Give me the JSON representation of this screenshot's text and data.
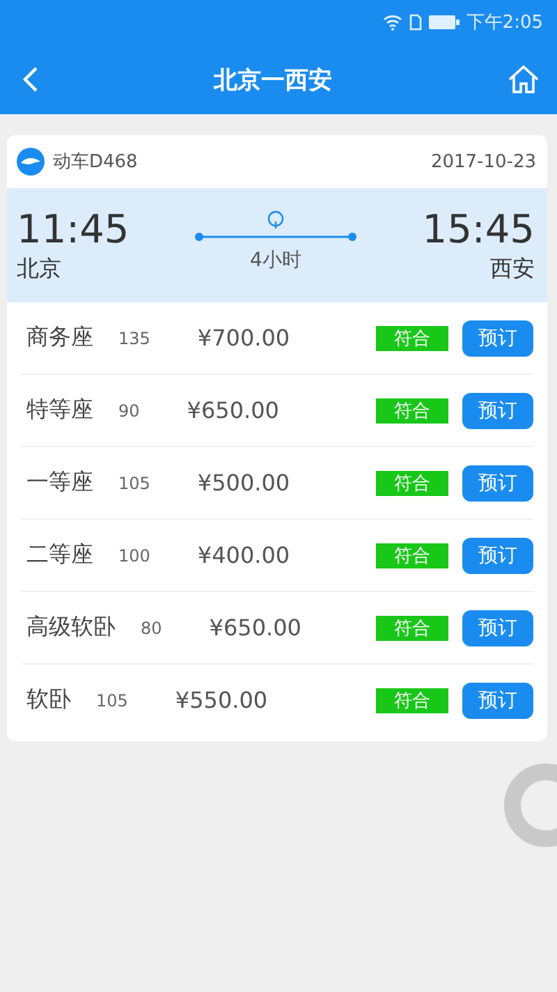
{
  "status_bar": {
    "time": "下午2:05"
  },
  "header": {
    "title": "北京一西安"
  },
  "train": {
    "name": "动车D468",
    "date": "2017-10-23",
    "depart_time": "11:45",
    "depart_station": "北京",
    "arrive_time": "15:45",
    "arrive_station": "西安",
    "duration": "4小时"
  },
  "seats": [
    {
      "name": "商务座",
      "count": "135",
      "price": "¥700.00",
      "tag": "符合",
      "button": "预订"
    },
    {
      "name": "特等座",
      "count": "90",
      "price": "¥650.00",
      "tag": "符合",
      "button": "预订"
    },
    {
      "name": "一等座",
      "count": "105",
      "price": "¥500.00",
      "tag": "符合",
      "button": "预订"
    },
    {
      "name": "二等座",
      "count": "100",
      "price": "¥400.00",
      "tag": "符合",
      "button": "预订"
    },
    {
      "name": "高级软卧",
      "count": "80",
      "price": "¥650.00",
      "tag": "符合",
      "button": "预订"
    },
    {
      "name": "软卧",
      "count": "105",
      "price": "¥550.00",
      "tag": "符合",
      "button": "预订"
    }
  ]
}
